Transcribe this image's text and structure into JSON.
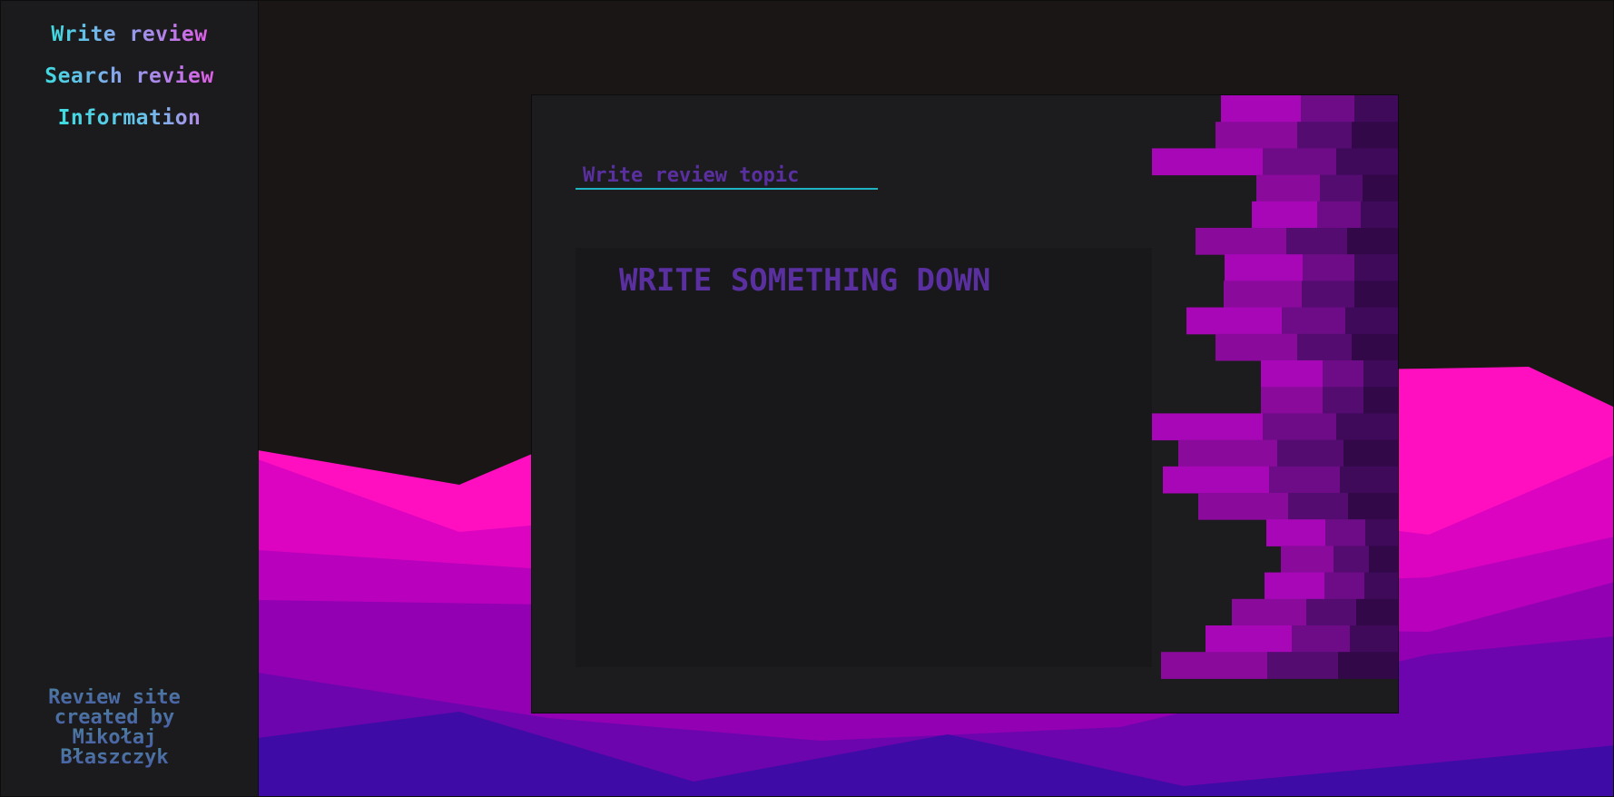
{
  "sidebar": {
    "items": [
      {
        "label": "Write review"
      },
      {
        "label": "Search review"
      },
      {
        "label": "Information"
      }
    ],
    "credits": [
      "Review site",
      "created by",
      "Mikołaj",
      "Błaszczyk"
    ]
  },
  "editor": {
    "topic_placeholder": "Write review topic",
    "body_placeholder": "WRITE SOMETHING DOWN"
  },
  "colors": {
    "accent_cyan": "#1fb3c4",
    "text_purple": "#5a2fa0",
    "mountain_pink": "#ff0fbf",
    "mountain_violet": "#3e0ba6"
  }
}
